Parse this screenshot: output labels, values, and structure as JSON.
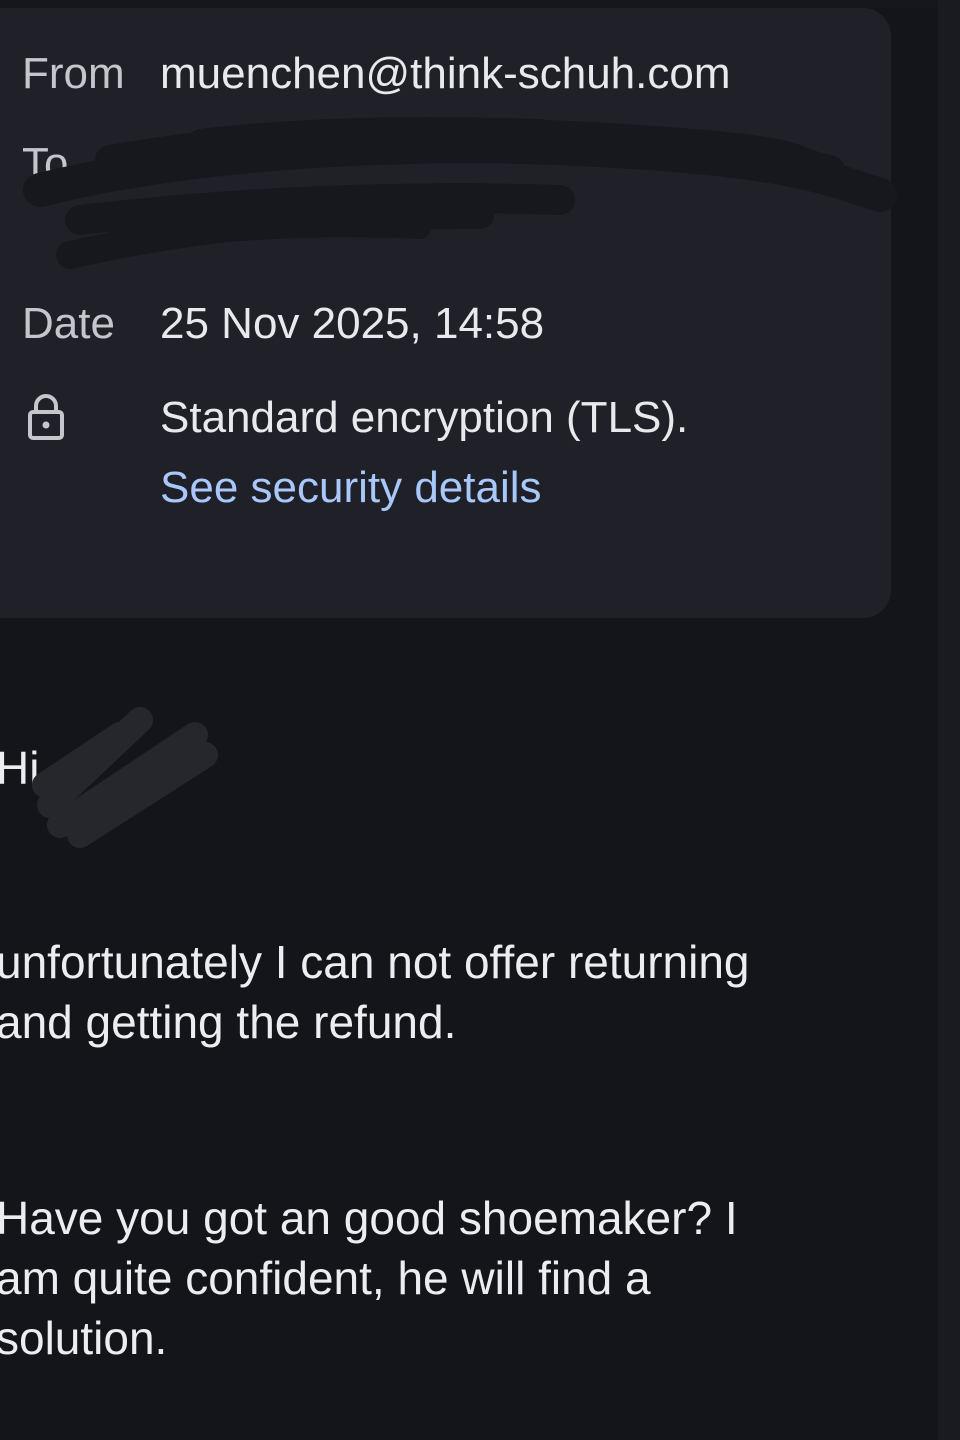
{
  "header": {
    "from_label": "From",
    "from_value": "muenchen@think-schuh.com",
    "to_label": "To",
    "to_value": "",
    "date_label": "Date",
    "date_value": "25 Nov 2025, 14:58",
    "encryption_text": "Standard encryption (TLS).",
    "security_link": "See security details",
    "lock_icon": "lock-icon"
  },
  "message": {
    "greeting": "Hi",
    "paragraph1_line1": "unfortunately I can not offer returning",
    "paragraph1_line2": "and getting the refund.",
    "paragraph2_line1": "Have you got an good shoemaker? I",
    "paragraph2_line2": "am quite confident, he will find a",
    "paragraph2_line3": "solution."
  },
  "colors": {
    "background": "#14151a",
    "card": "#202128",
    "link": "#a8c7fa",
    "text": "#e6e7ea"
  }
}
